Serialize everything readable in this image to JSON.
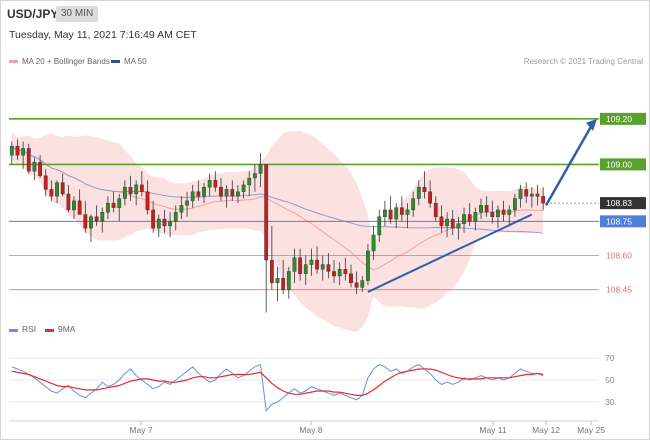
{
  "header": {
    "symbol": "USD/JPY",
    "timeframe": "30 MIN",
    "datetime": "Tuesday, May 11, 2021 7:16:49 AM CET"
  },
  "legend": {
    "bb_label": "MA 20 + Bollinger Bands",
    "ma50_label": "MA 50",
    "credit": "Research © 2021 Trading Central"
  },
  "colors": {
    "bb_fill": "#fcdcdc",
    "bb_line": "#f4a0a0",
    "ma50": "#2f4f8f",
    "green": "#5aa02c",
    "blue": "#4f7fd6",
    "red": "#ec7070",
    "rsi": "#6c8fe0",
    "rsi_ma": "#e03030",
    "arrow": "#2f5fa8"
  },
  "chart_data": [
    {
      "type": "candlestick",
      "x_ticks": [
        "May 7",
        "May 8",
        "May 11",
        "May 12",
        "May 25"
      ],
      "ylim": [
        108.33,
        109.41
      ],
      "levels": [
        {
          "label": "109.20",
          "value": 109.2,
          "style": "green"
        },
        {
          "label": "109.00",
          "value": 109.0,
          "style": "green"
        },
        {
          "label": "108.83",
          "value": 108.83,
          "style": "current"
        },
        {
          "label": "108.75",
          "value": 108.75,
          "style": "blue"
        },
        {
          "label": "108.60",
          "value": 108.6,
          "style": "red"
        },
        {
          "label": "108.45",
          "value": 108.45,
          "style": "red"
        }
      ],
      "candles": [
        [
          109.04,
          109.1,
          109.0,
          109.08
        ],
        [
          109.08,
          109.11,
          109.02,
          109.04
        ],
        [
          109.04,
          109.1,
          108.98,
          109.07
        ],
        [
          109.07,
          109.09,
          108.96,
          108.97
        ],
        [
          108.97,
          109.03,
          108.93,
          109.01
        ],
        [
          109.01,
          109.04,
          108.94,
          108.95
        ],
        [
          108.95,
          108.98,
          108.86,
          108.89
        ],
        [
          108.89,
          108.93,
          108.84,
          108.86
        ],
        [
          108.86,
          108.93,
          108.83,
          108.92
        ],
        [
          108.92,
          108.96,
          108.86,
          108.87
        ],
        [
          108.87,
          108.91,
          108.79,
          108.8
        ],
        [
          108.8,
          108.86,
          108.76,
          108.84
        ],
        [
          108.84,
          108.89,
          108.78,
          108.78
        ],
        [
          108.78,
          108.84,
          108.7,
          108.72
        ],
        [
          108.72,
          108.78,
          108.66,
          108.77
        ],
        [
          108.77,
          108.82,
          108.73,
          108.75
        ],
        [
          108.75,
          108.81,
          108.7,
          108.79
        ],
        [
          108.79,
          108.86,
          108.76,
          108.83
        ],
        [
          108.83,
          108.88,
          108.79,
          108.81
        ],
        [
          108.81,
          108.87,
          108.75,
          108.85
        ],
        [
          108.85,
          108.93,
          108.82,
          108.9
        ],
        [
          108.9,
          108.95,
          108.84,
          108.87
        ],
        [
          108.87,
          108.93,
          108.82,
          108.91
        ],
        [
          108.91,
          108.97,
          108.86,
          108.88
        ],
        [
          108.88,
          108.93,
          108.78,
          108.8
        ],
        [
          108.8,
          108.84,
          108.7,
          108.72
        ],
        [
          108.72,
          108.78,
          108.68,
          108.76
        ],
        [
          108.76,
          108.8,
          108.7,
          108.73
        ],
        [
          108.73,
          108.79,
          108.68,
          108.75
        ],
        [
          108.75,
          108.82,
          108.71,
          108.79
        ],
        [
          108.79,
          108.86,
          108.76,
          108.82
        ],
        [
          108.82,
          108.88,
          108.77,
          108.84
        ],
        [
          108.84,
          108.91,
          108.81,
          108.88
        ],
        [
          108.88,
          108.93,
          108.84,
          108.86
        ],
        [
          108.86,
          108.92,
          108.83,
          108.9
        ],
        [
          108.9,
          108.96,
          108.86,
          108.93
        ],
        [
          108.93,
          108.97,
          108.88,
          108.9
        ],
        [
          108.9,
          108.94,
          108.84,
          108.86
        ],
        [
          108.86,
          108.91,
          108.81,
          108.89
        ],
        [
          108.89,
          108.93,
          108.84,
          108.86
        ],
        [
          108.86,
          108.91,
          108.83,
          108.88
        ],
        [
          108.88,
          108.93,
          108.85,
          108.91
        ],
        [
          108.91,
          108.97,
          108.86,
          108.94
        ],
        [
          108.94,
          109.0,
          108.88,
          108.96
        ],
        [
          108.96,
          109.05,
          108.9,
          109.0
        ],
        [
          109.0,
          108.95,
          108.35,
          108.58
        ],
        [
          108.58,
          108.73,
          108.45,
          108.48
        ],
        [
          108.48,
          108.55,
          108.4,
          108.5
        ],
        [
          108.5,
          108.58,
          108.43,
          108.45
        ],
        [
          108.45,
          108.55,
          108.41,
          108.53
        ],
        [
          108.53,
          108.63,
          108.48,
          108.59
        ],
        [
          108.59,
          108.63,
          108.49,
          108.52
        ],
        [
          108.52,
          108.6,
          108.47,
          108.56
        ],
        [
          108.56,
          108.63,
          108.51,
          108.58
        ],
        [
          108.58,
          108.64,
          108.52,
          108.54
        ],
        [
          108.54,
          108.6,
          108.49,
          108.56
        ],
        [
          108.56,
          108.61,
          108.5,
          108.53
        ],
        [
          108.53,
          108.58,
          108.48,
          108.51
        ],
        [
          108.51,
          108.57,
          108.47,
          108.54
        ],
        [
          108.54,
          108.59,
          108.49,
          108.52
        ],
        [
          108.52,
          108.56,
          108.46,
          108.48
        ],
        [
          108.48,
          108.53,
          108.43,
          108.46
        ],
        [
          108.46,
          108.51,
          108.44,
          108.49
        ],
        [
          108.49,
          108.65,
          108.47,
          108.62
        ],
        [
          108.62,
          108.73,
          108.58,
          108.69
        ],
        [
          108.69,
          108.8,
          108.66,
          108.77
        ],
        [
          108.77,
          108.84,
          108.73,
          108.8
        ],
        [
          108.8,
          108.86,
          108.74,
          108.76
        ],
        [
          108.76,
          108.83,
          108.72,
          108.81
        ],
        [
          108.81,
          108.86,
          108.75,
          108.78
        ],
        [
          108.78,
          108.83,
          108.72,
          108.8
        ],
        [
          108.8,
          108.88,
          108.77,
          108.85
        ],
        [
          108.85,
          108.93,
          108.82,
          108.9
        ],
        [
          108.9,
          108.97,
          108.85,
          108.88
        ],
        [
          108.88,
          108.93,
          108.81,
          108.83
        ],
        [
          108.83,
          108.86,
          108.75,
          108.77
        ],
        [
          108.77,
          108.82,
          108.7,
          108.73
        ],
        [
          108.73,
          108.79,
          108.68,
          108.76
        ],
        [
          108.76,
          108.8,
          108.69,
          108.72
        ],
        [
          108.72,
          108.77,
          108.67,
          108.74
        ],
        [
          108.74,
          108.81,
          108.7,
          108.78
        ],
        [
          108.78,
          108.83,
          108.73,
          108.75
        ],
        [
          108.75,
          108.81,
          108.71,
          108.79
        ],
        [
          108.79,
          108.85,
          108.76,
          108.82
        ],
        [
          108.82,
          108.86,
          108.77,
          108.79
        ],
        [
          108.79,
          108.84,
          108.74,
          108.77
        ],
        [
          108.77,
          108.82,
          108.72,
          108.8
        ],
        [
          108.8,
          108.84,
          108.75,
          108.78
        ],
        [
          108.78,
          108.82,
          108.73,
          108.8
        ],
        [
          108.8,
          108.87,
          108.77,
          108.85
        ],
        [
          108.85,
          108.91,
          108.81,
          108.89
        ],
        [
          108.89,
          108.92,
          108.83,
          108.86
        ],
        [
          108.86,
          108.9,
          108.81,
          108.87
        ],
        [
          108.87,
          108.91,
          108.82,
          108.86
        ],
        [
          108.86,
          108.9,
          108.8,
          108.83
        ]
      ]
    },
    {
      "type": "line",
      "name": "RSI",
      "ylim": [
        20,
        80
      ],
      "y_ticks": [
        70,
        50,
        30
      ],
      "rsi": [
        62,
        60,
        58,
        55,
        52,
        48,
        44,
        40,
        38,
        42,
        45,
        40,
        36,
        34,
        38,
        42,
        48,
        44,
        46,
        50,
        56,
        60,
        54,
        50,
        46,
        42,
        44,
        48,
        46,
        50,
        54,
        58,
        62,
        56,
        52,
        48,
        50,
        56,
        60,
        56,
        52,
        54,
        58,
        62,
        64,
        22,
        28,
        30,
        34,
        38,
        42,
        38,
        40,
        44,
        42,
        40,
        38,
        36,
        38,
        36,
        34,
        32,
        36,
        52,
        60,
        64,
        62,
        58,
        60,
        56,
        58,
        62,
        64,
        60,
        56,
        50,
        46,
        48,
        46,
        48,
        52,
        50,
        52,
        54,
        52,
        50,
        52,
        50,
        52,
        56,
        60,
        58,
        56,
        56,
        54
      ],
      "ma": [
        58,
        57,
        56,
        55,
        53,
        51,
        49,
        47,
        45,
        44,
        44,
        43,
        42,
        41,
        41,
        41,
        42,
        43,
        44,
        45,
        47,
        49,
        50,
        51,
        51,
        50,
        49,
        49,
        48,
        48,
        49,
        50,
        52,
        53,
        53,
        52,
        52,
        53,
        54,
        55,
        55,
        55,
        55,
        56,
        57,
        52,
        47,
        43,
        40,
        38,
        37,
        37,
        38,
        39,
        40,
        40,
        40,
        39,
        39,
        38,
        37,
        36,
        36,
        38,
        41,
        45,
        49,
        52,
        55,
        57,
        58,
        59,
        60,
        60,
        60,
        59,
        57,
        55,
        53,
        52,
        51,
        51,
        51,
        51,
        52,
        52,
        52,
        52,
        52,
        53,
        54,
        55,
        55,
        56,
        55
      ]
    }
  ]
}
